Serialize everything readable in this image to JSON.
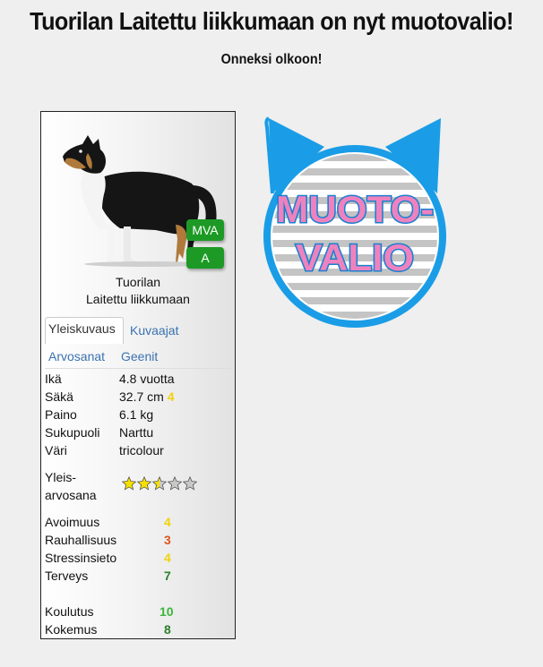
{
  "page": {
    "title": "Tuorilan Laitettu liikkumaan on nyt muotovalio!",
    "subtitle": "Onneksi olkoon!"
  },
  "card": {
    "badges": [
      "MVA",
      "A"
    ],
    "name_line1": "Tuorilan",
    "name_line2": "Laitettu liikkumaan",
    "tabs": [
      "Yleiskuvaus",
      "Kuvaajat",
      "Arvosanat",
      "Geenit"
    ],
    "stats": [
      {
        "label": "Ikä",
        "value": "4.8 vuotta"
      },
      {
        "label": "Säkä",
        "value": "32.7 cm",
        "score": "4"
      },
      {
        "label": "Paino",
        "value": "6.1 kg"
      },
      {
        "label": "Sukupuoli",
        "value": "Narttu"
      },
      {
        "label": "Väri",
        "value": "tricolour"
      }
    ],
    "overall_label_1": "Yleis-",
    "overall_label_2": "arvosana",
    "overall_stars": 2.5,
    "traits": [
      {
        "label": "Avoimuus",
        "value": "4",
        "color": "#f2d20a"
      },
      {
        "label": "Rauhallisuus",
        "value": "3",
        "color": "#e0531a"
      },
      {
        "label": "Stressinsieto",
        "value": "4",
        "color": "#f2d20a"
      },
      {
        "label": "Terveys",
        "value": "7",
        "color": "#2f7f2f"
      }
    ],
    "training": [
      {
        "label": "Koulutus",
        "value": "10",
        "color": "#3bb53b"
      },
      {
        "label": "Kokemus",
        "value": "8",
        "color": "#2f7f2f"
      }
    ]
  },
  "logo": {
    "line1": "MUOTO-",
    "line2": "VALIO",
    "colors": {
      "blue": "#1a9de6",
      "pink": "#ee82bf",
      "stripe": "#c4c4c4"
    }
  }
}
